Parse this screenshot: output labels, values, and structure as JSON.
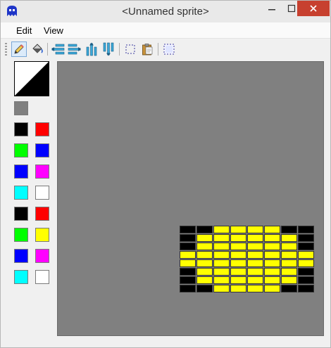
{
  "window": {
    "title": "<Unnamed sprite>"
  },
  "titlebar_icons": [
    "sprite-app-icon",
    "minimize-icon",
    "maximize-icon",
    "close-icon"
  ],
  "menu": {
    "items": [
      "Edit",
      "View"
    ]
  },
  "toolbar": {
    "tools": [
      {
        "name": "pencil-tool",
        "icon": "pencil-icon",
        "active": true
      },
      {
        "name": "fill-tool",
        "icon": "paint-bucket-icon",
        "active": false
      },
      {
        "name": "shift-left-tool",
        "icon": "shift-left-icon",
        "active": false
      },
      {
        "name": "shift-right-tool",
        "icon": "shift-right-icon",
        "active": false
      },
      {
        "name": "shift-up-tool",
        "icon": "shift-up-icon",
        "active": false
      },
      {
        "name": "shift-down-tool",
        "icon": "shift-down-icon",
        "active": false
      },
      {
        "name": "select-tool",
        "icon": "select-rect-icon",
        "active": false
      },
      {
        "name": "paste-tool",
        "icon": "clipboard-icon",
        "active": false
      },
      {
        "name": "select-all-tool",
        "icon": "select-all-icon",
        "active": false
      }
    ]
  },
  "palette": {
    "foreground": "#ffffff",
    "background": "#000000",
    "transparent": "#808080",
    "colors": [
      [
        "#000000",
        "#ff0000"
      ],
      [
        "#00ff00",
        "#0000ff"
      ],
      [
        "#0000ff",
        "#ff00ff"
      ],
      [
        "#00ffff",
        "#ffffff"
      ],
      [
        "#000000",
        "#ff0000"
      ],
      [
        "#00ff00",
        "#ffff00"
      ],
      [
        "#0000ff",
        "#ff00ff"
      ],
      [
        "#00ffff",
        "#ffffff"
      ]
    ]
  },
  "sprite": {
    "cols": 8,
    "rows": 8,
    "legend": {
      "K": "#000000",
      "Y": "#ffff00"
    },
    "pixels": [
      "KKYYYYKK",
      "KYYYYYYK",
      "KYYYYYYK",
      "YYYYYYYY",
      "YYYYYYYY",
      "KYYYYYYK",
      "KYYYYYYK",
      "KKYYYYKK"
    ]
  }
}
